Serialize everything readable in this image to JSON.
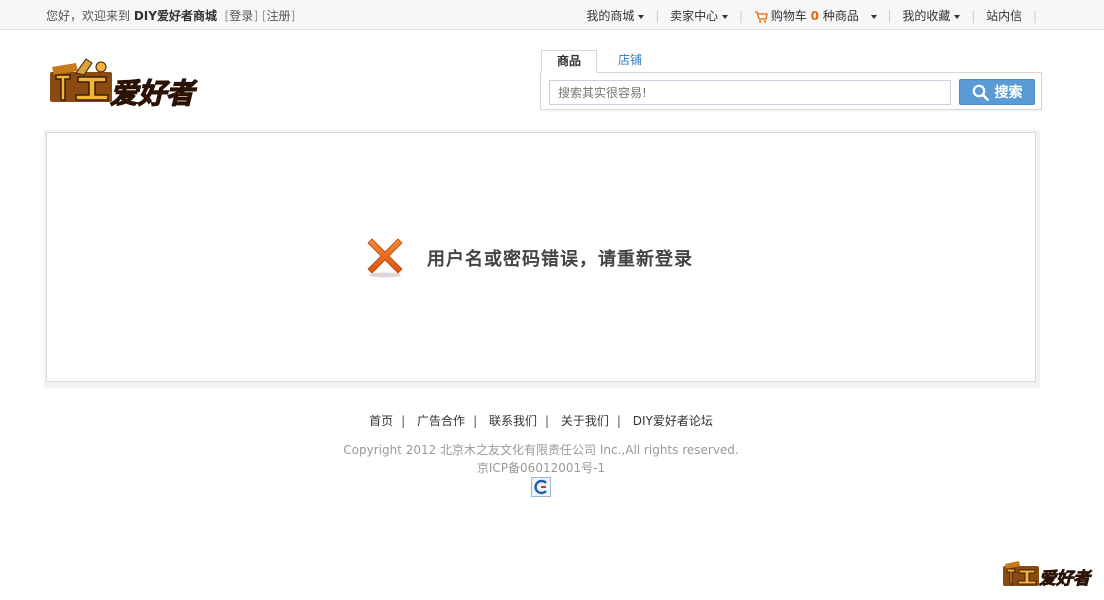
{
  "topbar": {
    "greeting": "您好，欢迎来到",
    "site_name": "DIY爱好者商城",
    "login": "登录",
    "register": "注册",
    "my_mall": "我的商城",
    "seller_center": "卖家中心",
    "cart_label": "购物车",
    "cart_count": "0",
    "cart_suffix": "种商品",
    "favorites": "我的收藏",
    "messages": "站内信"
  },
  "logo": {
    "text": "爱好者",
    "mark": "木工"
  },
  "search": {
    "tabs": [
      "商品",
      "店铺"
    ],
    "placeholder": "搜索其实很容易!",
    "button_label": "搜索"
  },
  "message": {
    "text": "用户名或密码错误，请重新登录",
    "icon": "error-x-icon"
  },
  "footer": {
    "links": [
      "首页",
      "广告合作",
      "联系我们",
      "关于我们",
      "DIY爱好者论坛"
    ],
    "copyright": "Copyright 2012 北京木之友文化有限责任公司 Inc.,All rights reserved.",
    "icp": "京ICP备06012001号-1"
  },
  "colors": {
    "accent_blue": "#5a9bd6",
    "error_orange": "#e8641b",
    "cart_count": "#e8640c",
    "tab_link": "#2e7bc4"
  }
}
